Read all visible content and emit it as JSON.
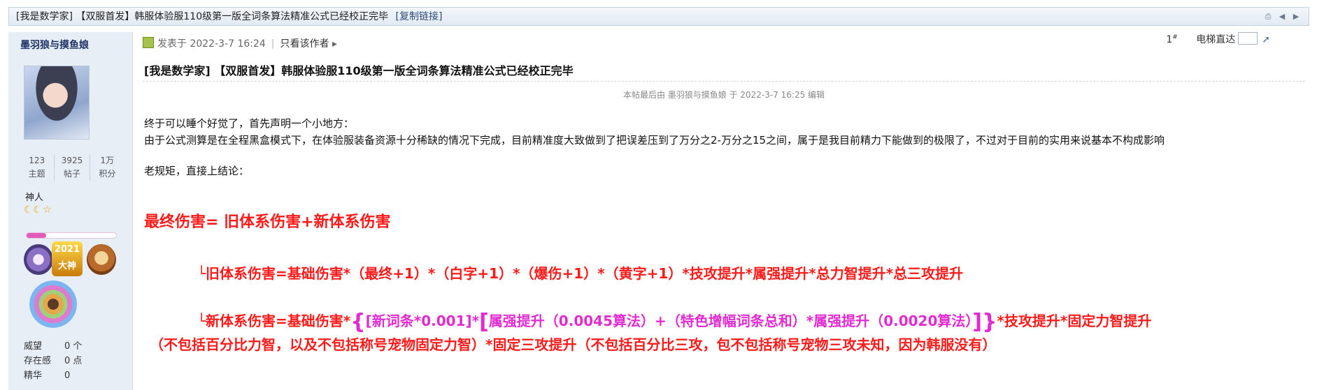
{
  "thread": {
    "title": "[我是数学家] 【双服首发】韩服体验服110级第一版全词条算法精准公式已经校正完毕",
    "copy_link": "[复制链接]"
  },
  "author": {
    "name": "墨羽狼与摸鱼娘",
    "stats": [
      {
        "value": "123",
        "label": "主题"
      },
      {
        "value": "3925",
        "label": "帖子"
      },
      {
        "value": "1万",
        "label": "积分"
      }
    ],
    "rank": "神人",
    "rank_progress": 0.22,
    "medal_year": "2021",
    "medal_sub": "大神",
    "meta": [
      {
        "k": "威望",
        "v": "0 个"
      },
      {
        "k": "存在感",
        "v": "0 点"
      },
      {
        "k": "精华",
        "v": "0"
      }
    ]
  },
  "post": {
    "posted_at": "发表于 2022-3-7 16:24",
    "only_author": "只看该作者",
    "floor": "1",
    "floor_mark": "#",
    "goto_label": "电梯直达",
    "title": "[我是数学家] 【双服首发】韩服体验服110级第一版全词条算法精准公式已经校正完毕",
    "edit_note": "本帖最后由 墨羽狼与摸鱼娘 于 2022-3-7 16:25 编辑",
    "para1": "终于可以睡个好觉了，首先声明一个小地方：",
    "para2": "由于公式测算是在全程黑盒模式下，在体验服装备资源十分稀缺的情况下完成，目前精准度大致做到了把误差压到了万分之2-万分之15之间，属于是我目前精力下能做到的极限了，不过对于目前的实用来说基本不构成影响",
    "para3": "老规矩，直接上结论：",
    "formula_main": "最终伤害= 旧体系伤害+新体系伤害",
    "formula_old": "└旧体系伤害=基础伤害*（最终+1）*（白字+1）*（爆伤+1）*（黄字+1）*技攻提升*属强提升*总力智提升*总三攻提升",
    "formula_new_a": "└新体系伤害=基础伤害*",
    "formula_new_brace_open": "{",
    "formula_new_b": "[新词条*0.001]*",
    "formula_new_bracket_open": "[",
    "formula_new_c": "属强提升（0.0045算法）+（特色增幅词条总和）*属强提升（0.0020算法）",
    "formula_new_bracket_close": "]",
    "formula_new_brace_close": "}",
    "formula_new_d": "*技攻提升*固定力智提升",
    "formula_new_cont": "（不包括百分比力智，以及不包括称号宠物固定力智）*固定三攻提升（不包括百分比三攻，包不包括称号宠物三攻未知，因为韩服没有）"
  },
  "colors": {
    "formula_red": "#ff1a1a",
    "formula_magenta": "#e22bd0",
    "sidebar_bg": "#e7eef6"
  }
}
